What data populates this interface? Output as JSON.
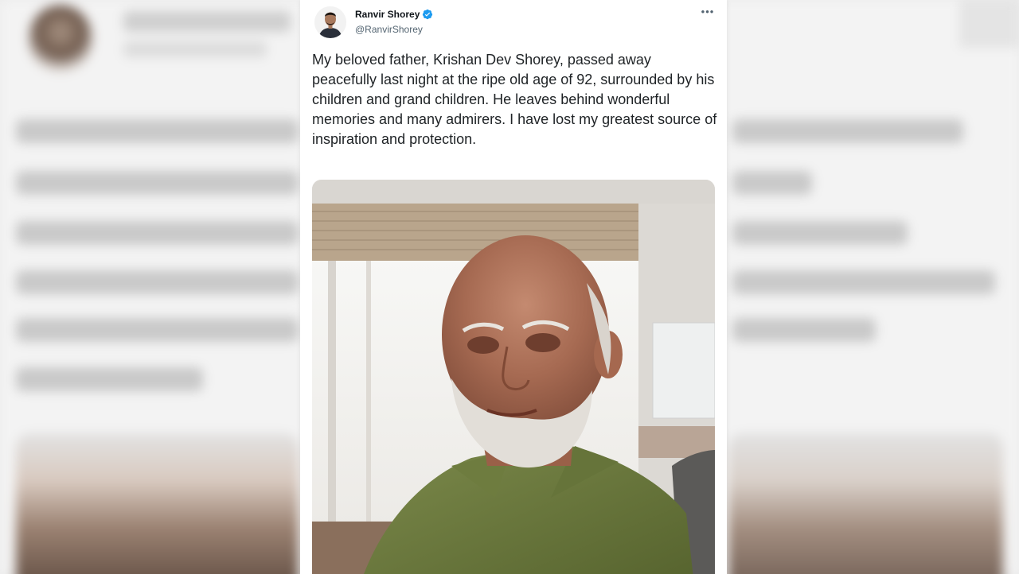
{
  "tweet": {
    "author_name": "Ranvir Shorey",
    "author_handle": "@RanvirShorey",
    "verified": true,
    "more_icon": "more-options-icon",
    "text": "My beloved father, Krishan Dev Shorey, passed away peacefully last night at the ripe old age of 92, surrounded by his children and grand children. He leaves behind wonderful memories and many admirers. I have lost my greatest source of inspiration and protection.",
    "media_description_icon": "photo-elderly-man"
  },
  "colors": {
    "verified_badge": "#1d9bf0",
    "handle_text": "#536471",
    "name_text": "#0f1419"
  }
}
